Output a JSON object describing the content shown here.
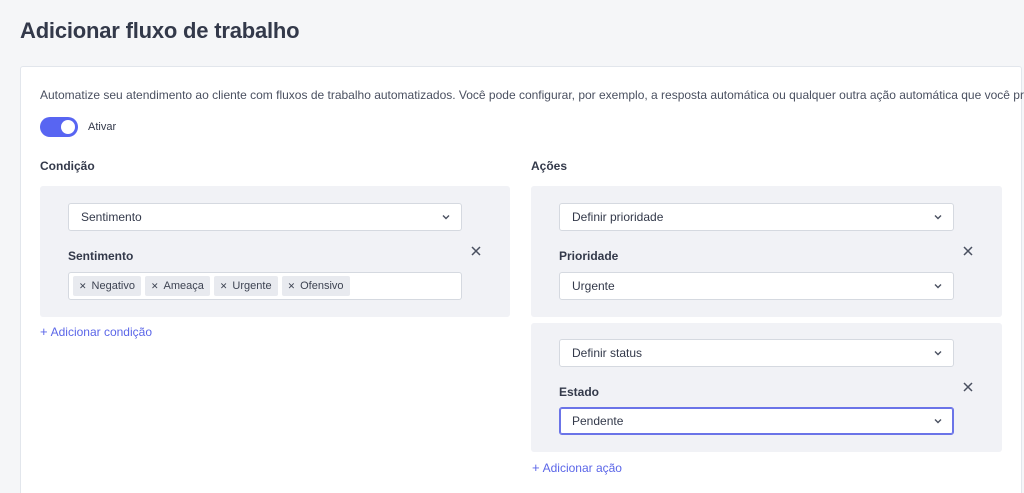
{
  "page": {
    "title": "Adicionar fluxo de trabalho"
  },
  "intro": {
    "description": "Automatize seu atendimento ao cliente com fluxos de trabalho automatizados. Você pode configurar, por exemplo, a resposta automática ou qualquer outra ação automática que você precisar.",
    "toggle_label": "Ativar",
    "toggle_on": true
  },
  "condition": {
    "title": "Condição",
    "type_select": "Sentimento",
    "field_label": "Sentimento",
    "tags": [
      "Negativo",
      "Ameaça",
      "Urgente",
      "Ofensivo"
    ],
    "add_label": "Adicionar condição"
  },
  "actions": {
    "title": "Ações",
    "items": [
      {
        "type_select": "Definir prioridade",
        "field_label": "Prioridade",
        "value": "Urgente"
      },
      {
        "type_select": "Definir status",
        "field_label": "Estado",
        "value": "Pendente"
      }
    ],
    "add_label": "Adicionar ação"
  },
  "colors": {
    "accent": "#5865f2",
    "panel": "#f1f2f6",
    "link": "#5b66e8"
  },
  "icons": {
    "chevron": "chevron-down-icon",
    "remove": "close-icon",
    "add": "plus-icon"
  }
}
